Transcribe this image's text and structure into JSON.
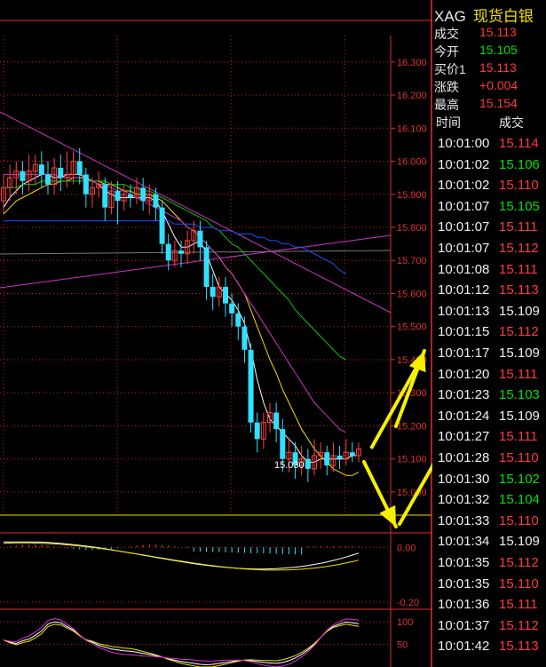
{
  "quote": {
    "symbol": "XAG",
    "name": "现货白银",
    "rows": [
      {
        "label": "成交",
        "value": "15.113",
        "color": "#ff3a3a"
      },
      {
        "label": "今开",
        "value": "15.105",
        "color": "#00e000"
      },
      {
        "label": "买价1",
        "value": "15.113",
        "color": "#ff3a3a"
      },
      {
        "label": "涨跌",
        "value": "+0.004",
        "color": "#ff3a3a"
      },
      {
        "label": "最高",
        "value": "15.154",
        "color": "#ff3a3a"
      }
    ]
  },
  "ticks_header": {
    "time": "时间",
    "price": "成交"
  },
  "ticks": [
    {
      "time": "10:01:00",
      "price": "15.114",
      "color": "#ff3a3a"
    },
    {
      "time": "10:01:02",
      "price": "15.106",
      "color": "#00e000"
    },
    {
      "time": "10:01:02",
      "price": "15.110",
      "color": "#ff3a3a"
    },
    {
      "time": "10:01:07",
      "price": "15.105",
      "color": "#00e000"
    },
    {
      "time": "10:01:07",
      "price": "15.111",
      "color": "#ff3a3a"
    },
    {
      "time": "10:01:07",
      "price": "15.112",
      "color": "#ff3a3a"
    },
    {
      "time": "10:01:08",
      "price": "15.111",
      "color": "#ff3a3a"
    },
    {
      "time": "10:01:12",
      "price": "15.113",
      "color": "#ff3a3a"
    },
    {
      "time": "10:01:13",
      "price": "15.109",
      "color": "#f0f0f0"
    },
    {
      "time": "10:01:15",
      "price": "15.112",
      "color": "#ff3a3a"
    },
    {
      "time": "10:01:17",
      "price": "15.109",
      "color": "#f0f0f0"
    },
    {
      "time": "10:01:20",
      "price": "15.111",
      "color": "#ff3a3a"
    },
    {
      "time": "10:01:23",
      "price": "15.103",
      "color": "#00e000"
    },
    {
      "time": "10:01:24",
      "price": "15.109",
      "color": "#f0f0f0"
    },
    {
      "time": "10:01:27",
      "price": "15.111",
      "color": "#ff3a3a"
    },
    {
      "time": "10:01:28",
      "price": "15.110",
      "color": "#ff3a3a"
    },
    {
      "time": "10:01:30",
      "price": "15.102",
      "color": "#00e000"
    },
    {
      "time": "10:01:32",
      "price": "15.104",
      "color": "#00e000"
    },
    {
      "time": "10:01:33",
      "price": "15.110",
      "color": "#ff3a3a"
    },
    {
      "time": "10:01:34",
      "price": "15.109",
      "color": "#f0f0f0"
    },
    {
      "time": "10:01:35",
      "price": "15.112",
      "color": "#ff3a3a"
    },
    {
      "time": "10:01:35",
      "price": "15.110",
      "color": "#ff3a3a"
    },
    {
      "time": "10:01:36",
      "price": "15.111",
      "color": "#ff3a3a"
    },
    {
      "time": "10:01:37",
      "price": "15.112",
      "color": "#ff3a3a"
    },
    {
      "time": "10:01:42",
      "price": "15.113",
      "color": "#ff3a3a"
    }
  ],
  "chart_data": {
    "type": "candlestick",
    "y_ticks": [
      "16.300",
      "16.200",
      "16.100",
      "16.000",
      "15.900",
      "15.800",
      "15.700",
      "15.600",
      "15.500",
      "15.400",
      "15.300",
      "15.200",
      "15.100",
      "15.000"
    ],
    "ylim": [
      14.93,
      16.38
    ],
    "low_label": "15.030",
    "candles": [
      {
        "o": 15.88,
        "c": 15.92,
        "h": 15.96,
        "l": 15.84
      },
      {
        "o": 15.92,
        "c": 15.95,
        "h": 15.99,
        "l": 15.88
      },
      {
        "o": 15.95,
        "c": 15.97,
        "h": 16.0,
        "l": 15.9
      },
      {
        "o": 15.97,
        "c": 15.94,
        "h": 16.0,
        "l": 15.9
      },
      {
        "o": 15.94,
        "c": 15.97,
        "h": 16.02,
        "l": 15.91
      },
      {
        "o": 15.97,
        "c": 15.99,
        "h": 16.02,
        "l": 15.93
      },
      {
        "o": 15.99,
        "c": 15.96,
        "h": 16.03,
        "l": 15.92
      },
      {
        "o": 15.96,
        "c": 15.93,
        "h": 16.0,
        "l": 15.9
      },
      {
        "o": 15.93,
        "c": 15.98,
        "h": 16.01,
        "l": 15.9
      },
      {
        "o": 15.98,
        "c": 15.95,
        "h": 16.02,
        "l": 15.91
      },
      {
        "o": 15.95,
        "c": 15.96,
        "h": 16.03,
        "l": 15.92
      },
      {
        "o": 15.96,
        "c": 16.0,
        "h": 16.03,
        "l": 15.93
      },
      {
        "o": 16.0,
        "c": 15.96,
        "h": 16.04,
        "l": 15.93
      },
      {
        "o": 15.96,
        "c": 15.9,
        "h": 15.98,
        "l": 15.86
      },
      {
        "o": 15.9,
        "c": 15.92,
        "h": 15.95,
        "l": 15.86
      },
      {
        "o": 15.92,
        "c": 15.93,
        "h": 15.97,
        "l": 15.89
      },
      {
        "o": 15.93,
        "c": 15.86,
        "h": 15.95,
        "l": 15.82
      },
      {
        "o": 15.86,
        "c": 15.91,
        "h": 15.94,
        "l": 15.84
      },
      {
        "o": 15.91,
        "c": 15.88,
        "h": 15.94,
        "l": 15.81
      },
      {
        "o": 15.88,
        "c": 15.9,
        "h": 15.93,
        "l": 15.85
      },
      {
        "o": 15.9,
        "c": 15.89,
        "h": 15.93,
        "l": 15.86
      },
      {
        "o": 15.89,
        "c": 15.92,
        "h": 15.95,
        "l": 15.87
      },
      {
        "o": 15.92,
        "c": 15.88,
        "h": 15.95,
        "l": 15.85
      },
      {
        "o": 15.88,
        "c": 15.9,
        "h": 15.93,
        "l": 15.84
      },
      {
        "o": 15.9,
        "c": 15.86,
        "h": 15.92,
        "l": 15.82
      },
      {
        "o": 15.86,
        "c": 15.75,
        "h": 15.88,
        "l": 15.72
      },
      {
        "o": 15.75,
        "c": 15.7,
        "h": 15.78,
        "l": 15.67
      },
      {
        "o": 15.7,
        "c": 15.73,
        "h": 15.76,
        "l": 15.68
      },
      {
        "o": 15.73,
        "c": 15.72,
        "h": 15.76,
        "l": 15.68
      },
      {
        "o": 15.72,
        "c": 15.76,
        "h": 15.79,
        "l": 15.69
      },
      {
        "o": 15.76,
        "c": 15.79,
        "h": 15.82,
        "l": 15.72
      },
      {
        "o": 15.79,
        "c": 15.74,
        "h": 15.82,
        "l": 15.7
      },
      {
        "o": 15.74,
        "c": 15.62,
        "h": 15.76,
        "l": 15.58
      },
      {
        "o": 15.62,
        "c": 15.59,
        "h": 15.66,
        "l": 15.55
      },
      {
        "o": 15.59,
        "c": 15.62,
        "h": 15.65,
        "l": 15.56
      },
      {
        "o": 15.62,
        "c": 15.57,
        "h": 15.65,
        "l": 15.53
      },
      {
        "o": 15.57,
        "c": 15.54,
        "h": 15.6,
        "l": 15.5
      },
      {
        "o": 15.54,
        "c": 15.5,
        "h": 15.57,
        "l": 15.46
      },
      {
        "o": 15.5,
        "c": 15.43,
        "h": 15.53,
        "l": 15.39
      },
      {
        "o": 15.43,
        "c": 15.21,
        "h": 15.45,
        "l": 15.18
      },
      {
        "o": 15.21,
        "c": 15.16,
        "h": 15.24,
        "l": 15.12
      },
      {
        "o": 15.16,
        "c": 15.21,
        "h": 15.24,
        "l": 15.13
      },
      {
        "o": 15.21,
        "c": 15.24,
        "h": 15.27,
        "l": 15.18
      },
      {
        "o": 15.24,
        "c": 15.19,
        "h": 15.27,
        "l": 15.15
      },
      {
        "o": 15.19,
        "c": 15.1,
        "h": 15.22,
        "l": 15.06
      },
      {
        "o": 15.1,
        "c": 15.12,
        "h": 15.16,
        "l": 15.06
      },
      {
        "o": 15.12,
        "c": 15.08,
        "h": 15.15,
        "l": 15.04
      },
      {
        "o": 15.08,
        "c": 15.1,
        "h": 15.14,
        "l": 15.05
      },
      {
        "o": 15.1,
        "c": 15.07,
        "h": 15.13,
        "l": 15.03
      },
      {
        "o": 15.07,
        "c": 15.11,
        "h": 15.16,
        "l": 15.05
      },
      {
        "o": 15.11,
        "c": 15.12,
        "h": 15.15,
        "l": 15.07
      },
      {
        "o": 15.12,
        "c": 15.08,
        "h": 15.14,
        "l": 15.05
      },
      {
        "o": 15.08,
        "c": 15.11,
        "h": 15.15,
        "l": 15.06
      },
      {
        "o": 15.11,
        "c": 15.1,
        "h": 15.14,
        "l": 15.07
      },
      {
        "o": 15.1,
        "c": 15.12,
        "h": 15.16,
        "l": 15.08
      },
      {
        "o": 15.12,
        "c": 15.11,
        "h": 15.15,
        "l": 15.09
      },
      {
        "o": 15.11,
        "c": 15.13,
        "h": 15.15,
        "l": 15.09
      }
    ],
    "moving_averages": [
      {
        "color": "#ffffff",
        "values": [
          15.86,
          15.89,
          15.91,
          15.93,
          15.94,
          15.95,
          15.96,
          15.96,
          15.95,
          15.95,
          15.96,
          15.96,
          15.96,
          15.95,
          15.94,
          15.93,
          15.91,
          15.9,
          15.89,
          15.89,
          15.89,
          15.89,
          15.89,
          15.89,
          15.88,
          15.85,
          15.81,
          15.77,
          15.74,
          15.74,
          15.75,
          15.76,
          15.72,
          15.67,
          15.62,
          15.6,
          15.58,
          15.55,
          15.51,
          15.43,
          15.34,
          15.27,
          15.22,
          15.2,
          15.18,
          15.16,
          15.14,
          15.11,
          15.09,
          15.09,
          15.1,
          15.1,
          15.1,
          15.1,
          15.1,
          15.11,
          15.11
        ]
      },
      {
        "color": "#f0e000",
        "values": [
          15.84,
          15.86,
          15.88,
          15.89,
          15.9,
          15.91,
          15.92,
          15.93,
          15.93,
          15.94,
          15.94,
          15.95,
          15.95,
          15.95,
          15.94,
          15.94,
          15.93,
          15.93,
          15.92,
          15.91,
          15.91,
          15.9,
          15.9,
          15.9,
          15.89,
          15.88,
          15.86,
          15.84,
          15.82,
          15.8,
          15.79,
          15.77,
          15.75,
          15.73,
          15.71,
          15.68,
          15.66,
          15.63,
          15.6,
          15.55,
          15.5,
          15.45,
          15.4,
          15.36,
          15.31,
          15.27,
          15.23,
          15.19,
          15.16,
          15.13,
          15.11,
          15.09,
          15.07,
          15.06,
          15.05,
          15.05,
          15.06
        ]
      },
      {
        "color": "#00cc00",
        "values": [
          15.92,
          15.92,
          15.92,
          15.93,
          15.93,
          15.93,
          15.94,
          15.94,
          15.94,
          15.94,
          15.94,
          15.94,
          15.94,
          15.94,
          15.94,
          15.94,
          15.94,
          15.93,
          15.93,
          15.93,
          15.92,
          15.92,
          15.91,
          15.91,
          15.9,
          15.89,
          15.88,
          15.87,
          15.86,
          15.85,
          15.84,
          15.83,
          15.82,
          15.8,
          15.79,
          15.77,
          15.75,
          15.74,
          15.72,
          15.7,
          15.68,
          15.66,
          15.64,
          15.62,
          15.6,
          15.58,
          15.55,
          15.53,
          15.51,
          15.49,
          15.47,
          15.45,
          15.43,
          15.41,
          15.4,
          null,
          null
        ]
      },
      {
        "color": "#cc33cc",
        "values": [
          15.96,
          15.96,
          15.96,
          15.96,
          15.96,
          15.96,
          15.96,
          15.96,
          15.96,
          15.95,
          15.95,
          15.95,
          15.95,
          15.94,
          15.94,
          15.93,
          15.93,
          15.92,
          15.91,
          15.91,
          15.9,
          15.89,
          15.88,
          15.87,
          15.86,
          15.85,
          15.84,
          15.83,
          15.82,
          15.8,
          15.79,
          15.77,
          15.75,
          15.73,
          15.71,
          15.68,
          15.66,
          15.63,
          15.6,
          15.57,
          15.54,
          15.51,
          15.48,
          15.45,
          15.42,
          15.39,
          15.36,
          15.33,
          15.3,
          15.27,
          15.25,
          15.23,
          15.21,
          15.19,
          15.18,
          null,
          null
        ]
      },
      {
        "color": "#2050ff",
        "values": [
          15.82,
          15.82,
          15.82,
          15.82,
          15.82,
          15.82,
          15.82,
          15.82,
          15.82,
          15.82,
          15.82,
          15.82,
          15.82,
          15.82,
          15.82,
          15.82,
          15.82,
          15.82,
          15.82,
          15.82,
          15.82,
          15.82,
          15.82,
          15.82,
          15.82,
          15.82,
          15.82,
          15.81,
          15.81,
          15.81,
          15.81,
          15.8,
          15.8,
          15.8,
          15.79,
          15.79,
          15.79,
          15.78,
          15.78,
          15.78,
          15.77,
          15.77,
          15.76,
          15.76,
          15.75,
          15.75,
          15.74,
          15.74,
          15.73,
          15.72,
          15.71,
          15.7,
          15.69,
          15.67,
          15.66,
          null,
          null
        ]
      }
    ],
    "macd": {
      "yticks": [
        "0.00",
        "-0.20"
      ],
      "ylim": [
        -0.22,
        0.04
      ]
    },
    "kdj": {
      "yticks": [
        "100",
        "50"
      ],
      "ylim": [
        0,
        120
      ]
    }
  }
}
